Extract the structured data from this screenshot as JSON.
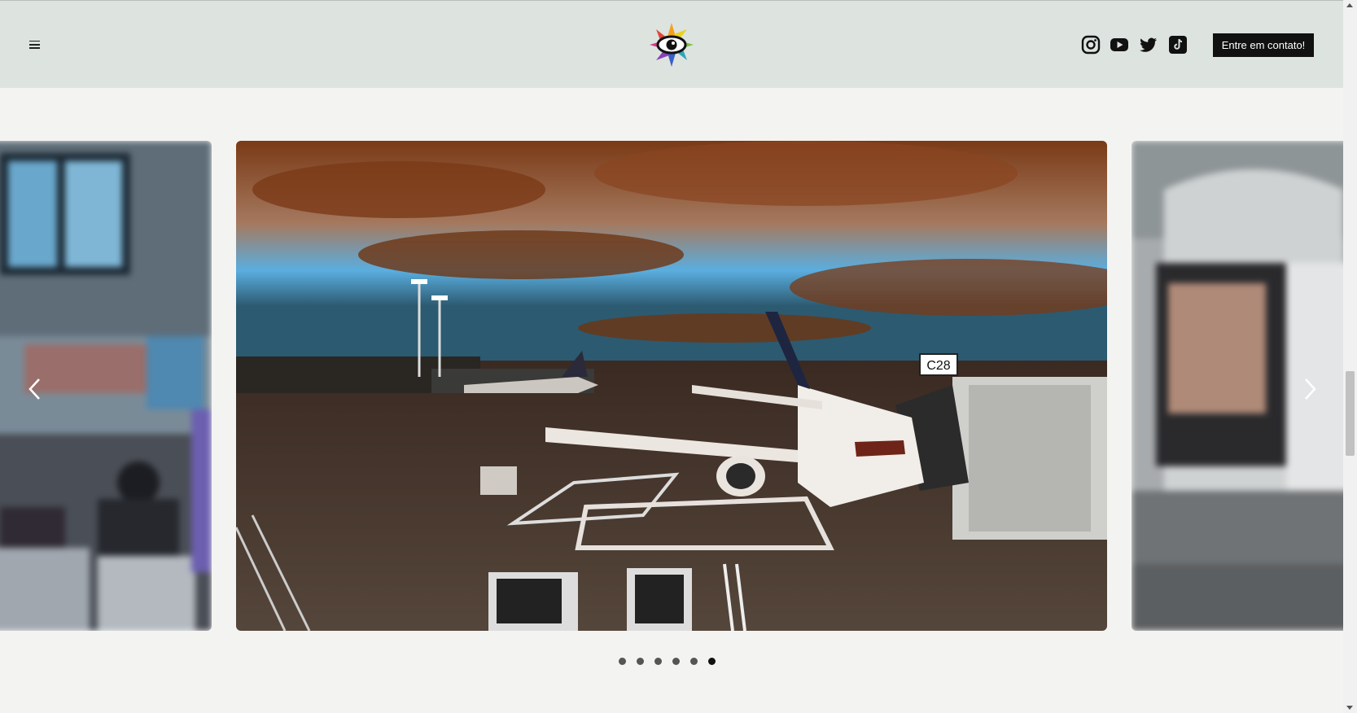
{
  "header": {
    "menu_icon": "hamburger-menu-icon",
    "logo_icon": "rainbow-eye-logo",
    "social": [
      {
        "name": "instagram-icon"
      },
      {
        "name": "youtube-icon"
      },
      {
        "name": "twitter-icon"
      },
      {
        "name": "tiktok-icon"
      }
    ],
    "cta_label": "Entre em contato!"
  },
  "carousel": {
    "slides": [
      "airport-terminal-departure-board",
      "airplane-at-gate-sunset",
      "airplane-window-seat"
    ],
    "active_index": 5,
    "dot_count": 6
  },
  "colors": {
    "header_bg": "#dde3df",
    "page_bg": "#f3f4f2",
    "cta_bg": "#111111",
    "cta_text": "#ffffff"
  }
}
